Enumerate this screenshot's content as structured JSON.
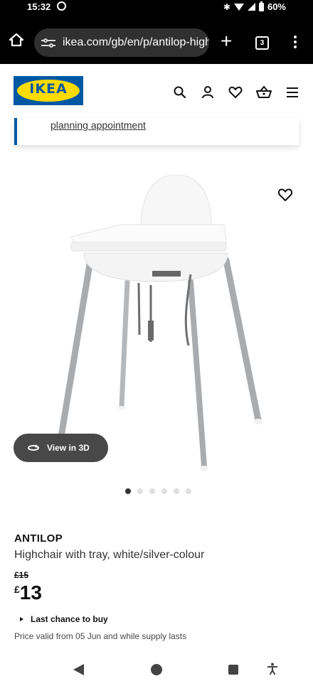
{
  "status_bar": {
    "time": "15:32",
    "battery": "60%",
    "icons": [
      "whatsapp-icon",
      "bluetooth-icon",
      "wifi-icon",
      "signal-icon",
      "battery-icon"
    ]
  },
  "browser": {
    "url": "ikea.com/gb/en/p/antilop-high",
    "tab_count": "3",
    "new_tab_symbol": "+"
  },
  "header": {
    "logo_text": "IKEA",
    "icons": [
      "search-icon",
      "user-icon",
      "heart-icon",
      "basket-icon",
      "menu-icon"
    ]
  },
  "banner": {
    "link_text": "planning appointment"
  },
  "gallery": {
    "view_3d_label": "View in 3D",
    "slide_count": 6,
    "active_slide": 1
  },
  "product": {
    "name": "ANTILOP",
    "description": "Highchair with tray, white/silver-colour",
    "old_price": "£15",
    "currency": "£",
    "price": "13",
    "last_chance": "Last chance to buy",
    "price_valid": "Price valid from 05 Jun and while supply lasts"
  },
  "colors": {
    "ikea_blue": "#0058a3",
    "ikea_yellow": "#ffdb00",
    "button_dark": "#484848"
  }
}
